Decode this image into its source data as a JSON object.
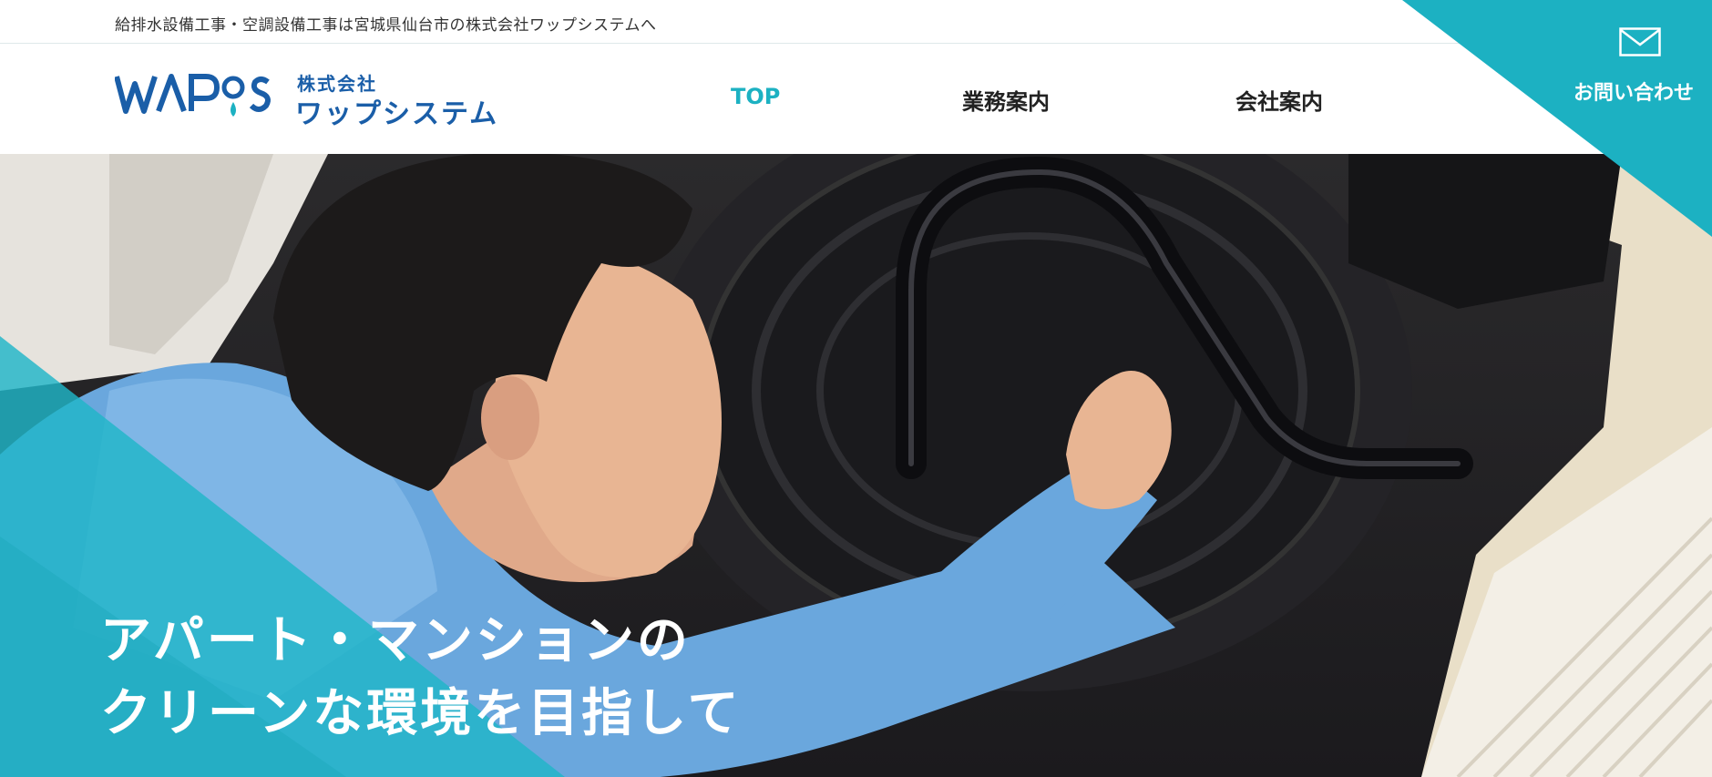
{
  "topbar": {
    "text": "給排水設備工事・空調設備工事は宮城県仙台市の株式会社ワップシステムへ"
  },
  "logo": {
    "mark": "WAP'S",
    "company_type": "株式会社",
    "company_name": "ワップシステム"
  },
  "nav": {
    "items": [
      {
        "label": "TOP",
        "active": true
      },
      {
        "label": "業務案内",
        "active": false
      },
      {
        "label": "会社案内",
        "active": false
      }
    ]
  },
  "contact": {
    "label": "お問い合わせ",
    "icon": "mail-icon"
  },
  "hero": {
    "line1": "アパート・マンションの",
    "line2": "クリーンな環境を目指して"
  },
  "colors": {
    "accent": "#1cb1c2",
    "brand_blue": "#1a5ea8",
    "teal_overlay": "#20b6c8"
  }
}
